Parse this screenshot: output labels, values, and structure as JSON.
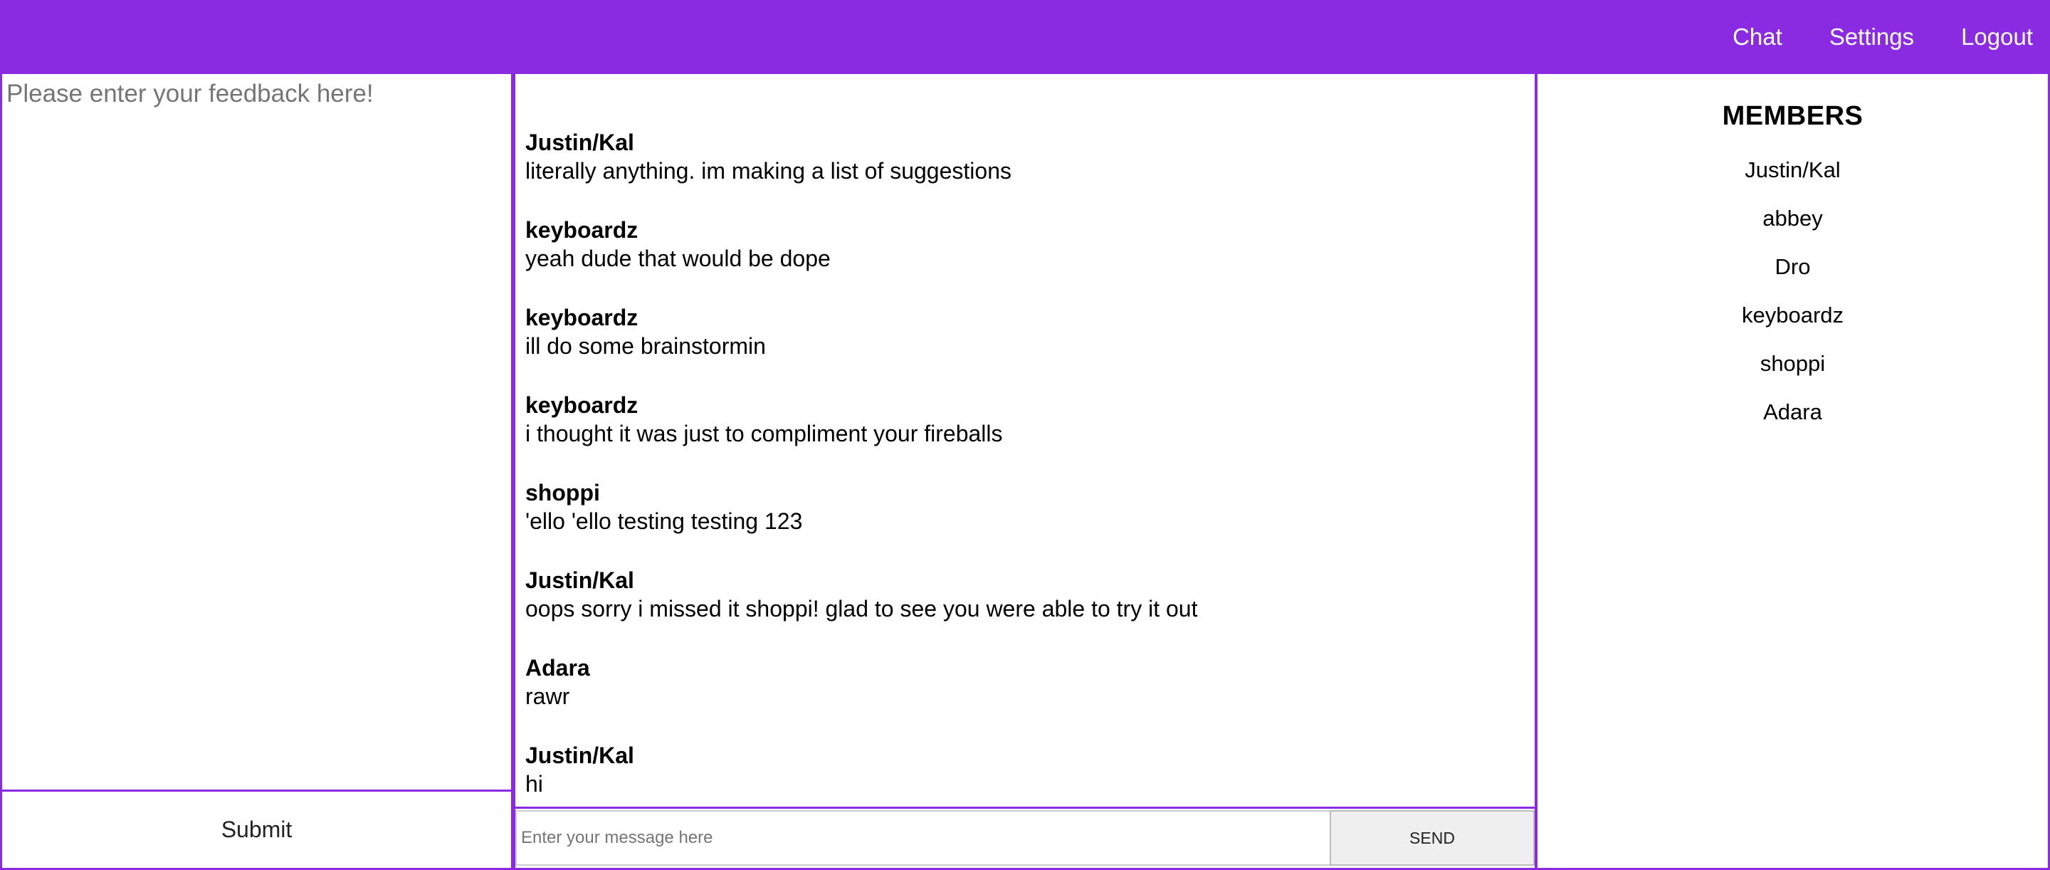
{
  "nav": {
    "chat": "Chat",
    "settings": "Settings",
    "logout": "Logout"
  },
  "feedback": {
    "placeholder": "Please enter your feedback here!",
    "submit_label": "Submit"
  },
  "chat": {
    "messages": [
      {
        "user": "Justin/Kal",
        "text": "literally anything. im making a list of suggestions"
      },
      {
        "user": "keyboardz",
        "text": "yeah dude that would be dope"
      },
      {
        "user": "keyboardz",
        "text": "ill do some brainstormin"
      },
      {
        "user": "keyboardz",
        "text": "i thought it was just to compliment your fireballs"
      },
      {
        "user": "shoppi",
        "text": "'ello 'ello testing testing 123"
      },
      {
        "user": "Justin/Kal",
        "text": "oops sorry i missed it shoppi! glad to see you were able to try it out"
      },
      {
        "user": "Adara",
        "text": "rawr"
      },
      {
        "user": "Justin/Kal",
        "text": "hi"
      }
    ],
    "input_placeholder": "Enter your message here",
    "send_label": "SEND"
  },
  "members": {
    "title": "MEMBERS",
    "list": [
      "Justin/Kal",
      "abbey",
      "Dro",
      "keyboardz",
      "shoppi",
      "Adara"
    ]
  },
  "colors": {
    "accent": "#8a2be2"
  }
}
